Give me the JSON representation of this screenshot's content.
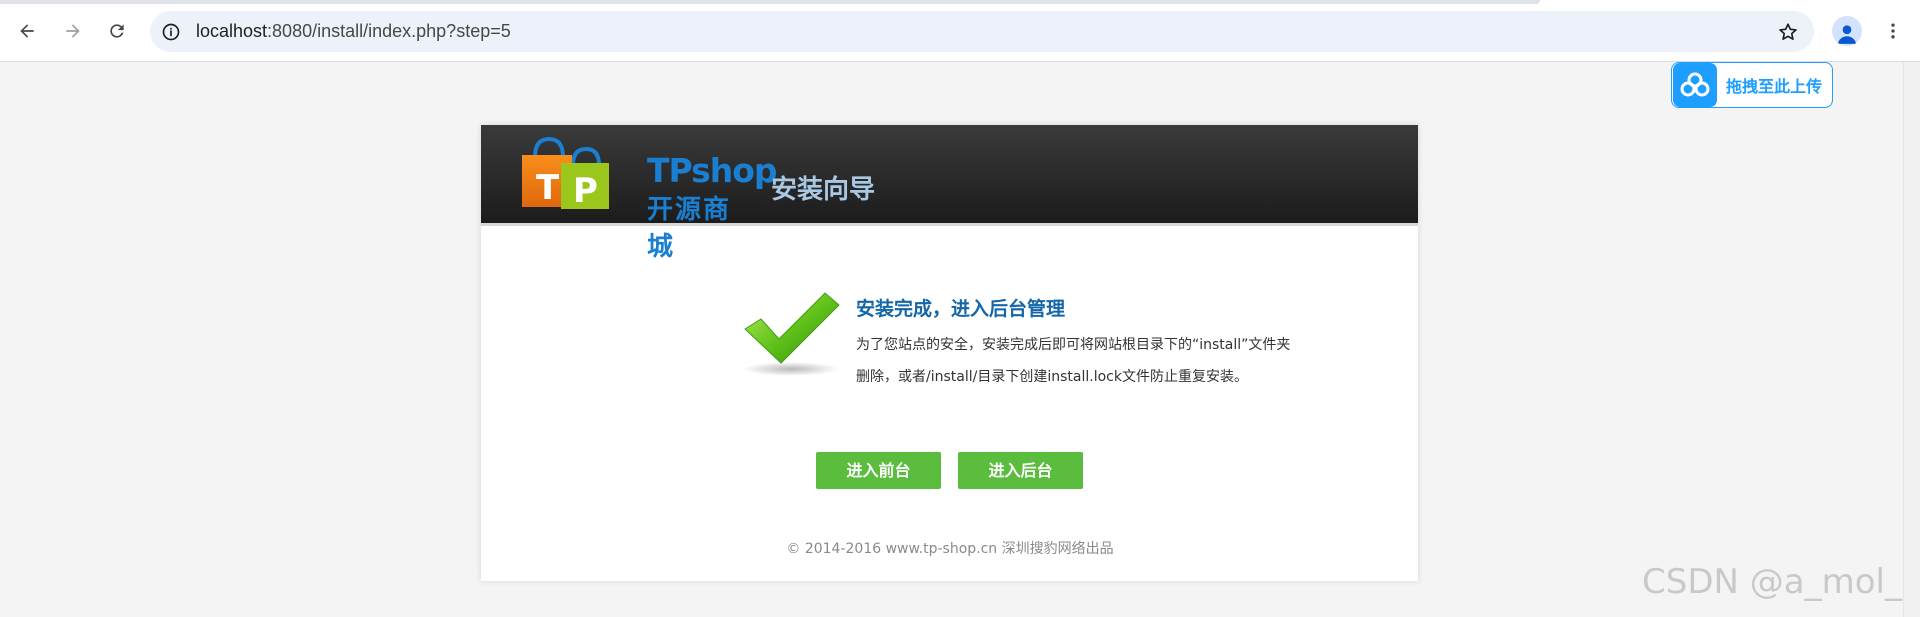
{
  "browser": {
    "url_host": "localhost",
    "url_rest": ":8080/install/index.php?step=5"
  },
  "icons": {
    "back": "arrow-left-icon",
    "forward": "arrow-right-icon",
    "reload": "reload-icon",
    "site_info": "info-icon",
    "bookmark": "star-icon",
    "profile": "person-icon",
    "menu": "three-dots-icon",
    "upload": "cloud-icon",
    "success": "checkmark-icon"
  },
  "upload_widget": {
    "label": "拖拽至此上传"
  },
  "install": {
    "logo_en": "TPshop",
    "logo_cn": "开源商城",
    "wizard_title": "安装向导",
    "done_title": "安装完成，进入后台管理",
    "done_desc_line1": "为了您站点的安全，安装完成后即可将网站根目录下的“install”文件夹",
    "done_desc_line2": "删除，或者/install/目录下创建install.lock文件防止重复安装。",
    "btn_front": "进入前台",
    "btn_admin": "进入后台"
  },
  "footer": {
    "text": "© 2014-2016 www.tp-shop.cn 深圳搜豹网络出品"
  },
  "watermark": {
    "text": "CSDN @a_mol_"
  },
  "colors": {
    "accent_green": "#5bbd3e",
    "title_blue": "#1366a7",
    "upload_blue": "#1e9fff"
  }
}
